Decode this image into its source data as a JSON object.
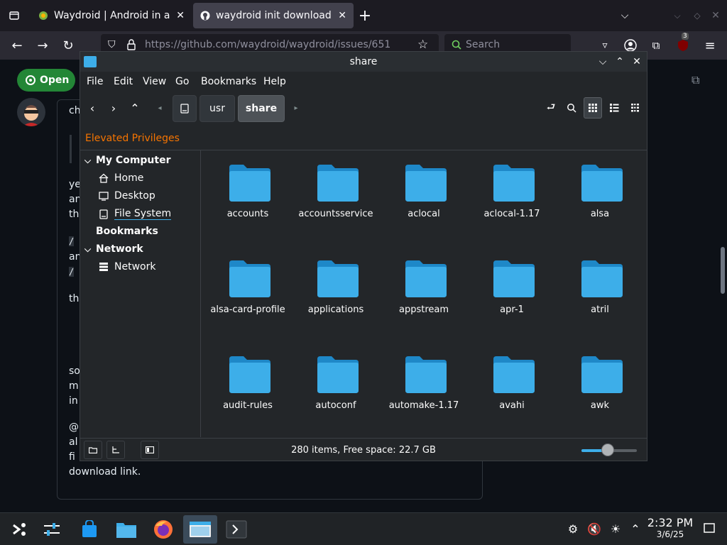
{
  "browser": {
    "tabs": [
      {
        "title": "Waydroid | Android in a Li",
        "icon": "waydroid-icon"
      },
      {
        "title": "waydroid init download ge",
        "icon": "github-icon"
      }
    ],
    "new_tab": "+",
    "url": "https://github.com/waydroid/waydroid/issues/651",
    "search_placeholder": "Search",
    "extension_badge": "3"
  },
  "github": {
    "open_label": "Open",
    "snippets": [
      "ch",
      "ye",
      "an",
      "th",
      "/",
      "an",
      "/",
      "th",
      "so",
      "m",
      "in",
      "@",
      "al",
      "fi",
      "download link."
    ]
  },
  "dolphin": {
    "title": "share",
    "menu": [
      "File",
      "Edit",
      "View",
      "Go",
      "Bookmarks",
      "Help"
    ],
    "breadcrumbs": [
      "usr",
      "share"
    ],
    "elevated": "Elevated Privileges",
    "places": {
      "my_computer": "My Computer",
      "home": "Home",
      "desktop": "Desktop",
      "file_system": "File System",
      "bookmarks": "Bookmarks",
      "network_header": "Network",
      "network": "Network"
    },
    "folders": [
      "accounts",
      "accountsservice",
      "aclocal",
      "aclocal-1.17",
      "alsa",
      "alsa-card-profile",
      "applications",
      "appstream",
      "apr-1",
      "atril",
      "audit-rules",
      "autoconf",
      "automake-1.17",
      "avahi",
      "awk"
    ],
    "status": "280 items, Free space: 22.7 GB",
    "zoom_level": 0.48,
    "accent": "#3daee9",
    "warning": "#f67400"
  },
  "clock": {
    "time": "2:32 PM",
    "date": "3/6/25"
  }
}
